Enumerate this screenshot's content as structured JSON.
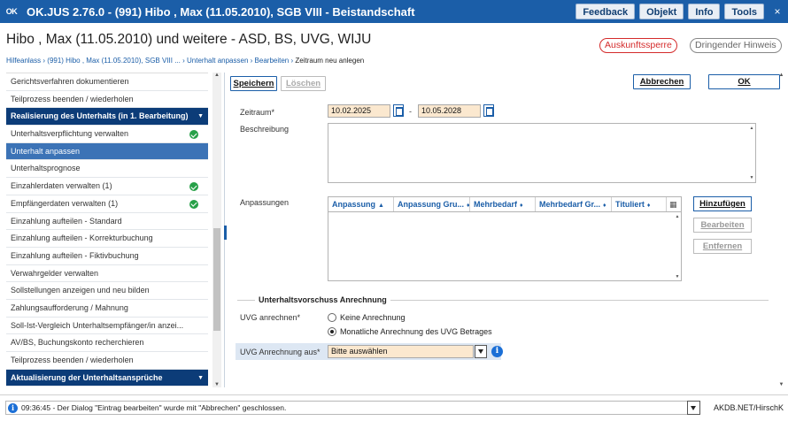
{
  "titlebar": {
    "logo": "OK",
    "title": "OK.JUS 2.76.0 - (991) Hibo , Max (11.05.2010), SGB VIII - Beistandschaft",
    "buttons": [
      "Feedback",
      "Objekt",
      "Info",
      "Tools"
    ],
    "close": "×"
  },
  "header": {
    "title": "Hibo , Max (11.05.2010) und weitere - ASD, BS, UVG, WIJU",
    "badge_red": "Auskunftssperre",
    "badge_grey": "Dringender Hinweis",
    "breadcrumb": [
      "Hilfeanlass",
      "(991) Hibo , Max (11.05.2010), SGB VIII ...",
      "Unterhalt anpassen",
      "Bearbeiten"
    ],
    "breadcrumb_current": "Zeitraum  neu anlegen",
    "breadcrumb_sep": "›"
  },
  "sidebar": {
    "items": [
      {
        "label": "Gerichtsverfahren dokumentieren"
      },
      {
        "label": "Teilprozess beenden / wiederholen"
      },
      {
        "label": "Realisierung des Unterhalts (in 1. Bearbeitung)"
      },
      {
        "label": "Unterhaltsverpflichtung verwalten"
      },
      {
        "label": "Unterhalt anpassen"
      },
      {
        "label": "Unterhaltsprognose"
      },
      {
        "label": "Einzahlerdaten verwalten (1)"
      },
      {
        "label": "Empfängerdaten verwalten (1)"
      },
      {
        "label": "Einzahlung aufteilen - Standard"
      },
      {
        "label": "Einzahlung aufteilen - Korrekturbuchung"
      },
      {
        "label": "Einzahlung aufteilen - Fiktivbuchung"
      },
      {
        "label": "Verwahrgelder verwalten"
      },
      {
        "label": "Sollstellungen anzeigen und neu bilden"
      },
      {
        "label": "Zahlungsaufforderung / Mahnung"
      },
      {
        "label": "Soll-Ist-Vergleich Unterhaltsempfänger/in anzei..."
      },
      {
        "label": "AV/BS, Buchungskonto recherchieren"
      },
      {
        "label": "Teilprozess beenden / wiederholen"
      },
      {
        "label": "Aktualisierung der Unterhaltsansprüche"
      }
    ]
  },
  "toolbar": {
    "save": "Speichern",
    "delete": "Löschen",
    "cancel": "Abbrechen",
    "ok": "OK"
  },
  "form": {
    "zeitraum_label": "Zeitraum*",
    "date_from": "10.02.2025",
    "date_sep": "-",
    "date_to": "10.05.2028",
    "beschreibung_label": "Beschreibung",
    "beschreibung_value": "",
    "anpassungen_label": "Anpassungen",
    "table_headers": [
      "Anpassung",
      "Anpassung Gru...",
      "Mehrbedarf",
      "Mehrbedarf Gr...",
      "Tituliert"
    ],
    "add": "Hinzufügen",
    "edit": "Bearbeiten",
    "remove": "Entfernen",
    "section_title": "Unterhaltsvorschuss Anrechnung",
    "uvg_label": "UVG anrechnen*",
    "radio_none": "Keine Anrechnung",
    "radio_monthly": "Monatliche Anrechnung des UVG Betrages",
    "uvg_aus_label": "UVG Anrechnung aus*",
    "uvg_aus_value": "Bitte auswählen",
    "info": "i"
  },
  "status": {
    "message": "09:36:45 - Der Dialog \"Eintrag bearbeiten\" wurde mit \"Abbrechen\" geschlossen.",
    "info": "i",
    "user": "AKDB.NET/HirschK"
  },
  "colors": {
    "titlebar": "#1b5ea8",
    "sidebar_head": "#0c3c78",
    "sidebar_active": "#3c73b6",
    "mandatory_field": "#fbe8cf",
    "check": "#27a048",
    "warning": "#d42b2b"
  }
}
